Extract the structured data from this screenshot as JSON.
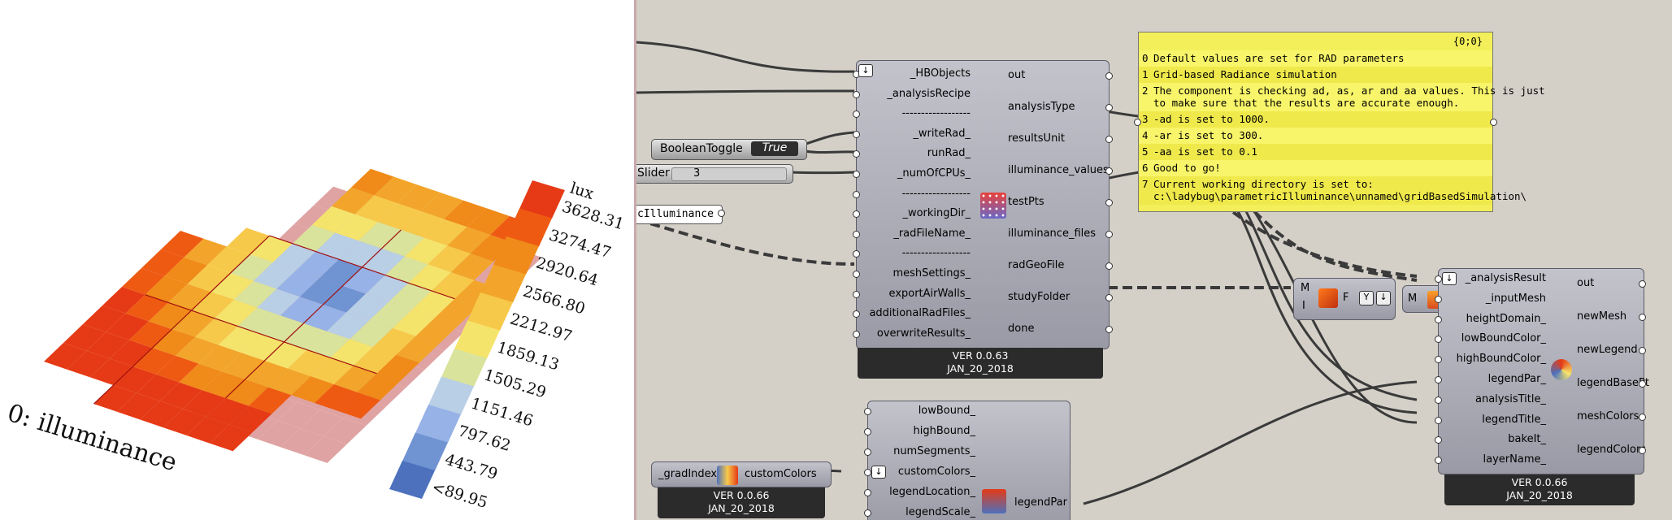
{
  "viewport": {
    "title": "0: illuminance",
    "legend_title": "lux",
    "legend_values": [
      "3628.31",
      "3274.47",
      "2920.64",
      "2566.80",
      "2212.97",
      "1859.13",
      "1505.29",
      "1151.46",
      "797.62",
      "443.79",
      "<89.95"
    ],
    "legend_colors": [
      "#e53a15",
      "#ee5a12",
      "#f08a18",
      "#f2a52a",
      "#f7c94a",
      "#f5e46c",
      "#d9e39c",
      "#b9cfe6",
      "#97b2e6",
      "#7093d2",
      "#4d71bd"
    ]
  },
  "hb_component": {
    "inputs": [
      "_HBObjects",
      "_analysisRecipe",
      "------------------",
      "_writeRad_",
      "runRad_",
      "_numOfCPUs_",
      "------------------",
      "_workingDir_",
      "_radFileName_",
      "------------------",
      "meshSettings_",
      "exportAirWalls_",
      "additionalRadFiles_",
      "overwriteResults_"
    ],
    "outputs": [
      "out",
      "analysisType",
      "resultsUnit",
      "illuminance_values",
      "testPts",
      "illuminance_files",
      "radGeoFile",
      "studyFolder",
      "done"
    ],
    "version": "VER 0.0.63",
    "date": "JAN_20_2018"
  },
  "boolean_toggle": {
    "label": "BooleanToggle",
    "value": "True"
  },
  "slider": {
    "label": "Slider",
    "value": "3"
  },
  "text_param": {
    "value": "cIlluminance"
  },
  "panel": {
    "header": "{0;0}",
    "rows": [
      {
        "index": "0",
        "text": "Default values are set for RAD parameters"
      },
      {
        "index": "1",
        "text": "Grid-based Radiance simulation"
      },
      {
        "index": "2",
        "text": "The component is checking ad, as, ar and aa values. This is just\nto make sure that the results are accurate enough."
      },
      {
        "index": "3",
        "text": "-ad is set to 1000."
      },
      {
        "index": "4",
        "text": "-ar is set to 300."
      },
      {
        "index": "5",
        "text": "-aa is set to 0.1"
      },
      {
        "index": "6",
        "text": "Good to go!"
      },
      {
        "index": "7",
        "text": "Current working directory is set to:\nc:\\ladybug\\parametricIlluminance\\unnamed\\gridBasedSimulation\\"
      }
    ]
  },
  "flatten": {
    "input1": "M",
    "input2": "I",
    "output": "F"
  },
  "mesh_comp": {
    "input": "M",
    "output": "M"
  },
  "recolor_component": {
    "inputs": [
      "_analysisResult",
      "_inputMesh",
      "heightDomain_",
      "lowBoundColor_",
      "highBoundColor_",
      "legendPar_",
      "analysisTitle_",
      "legendTitle_",
      "bakeIt_",
      "layerName_"
    ],
    "outputs": [
      "out",
      "newMesh",
      "newLegend",
      "legendBasePt",
      "meshColors",
      "legendColors"
    ],
    "version": "VER 0.0.66",
    "date": "JAN_20_2018"
  },
  "gradient_component": {
    "input": "_gradIndex",
    "output": "customColors",
    "version": "VER 0.0.66",
    "date": "JAN_20_2018"
  },
  "legend_component": {
    "inputs": [
      "lowBound_",
      "highBound_",
      "numSegments_",
      "customColors_",
      "legendLocation_",
      "legendScale_"
    ],
    "output": "legendPar"
  }
}
